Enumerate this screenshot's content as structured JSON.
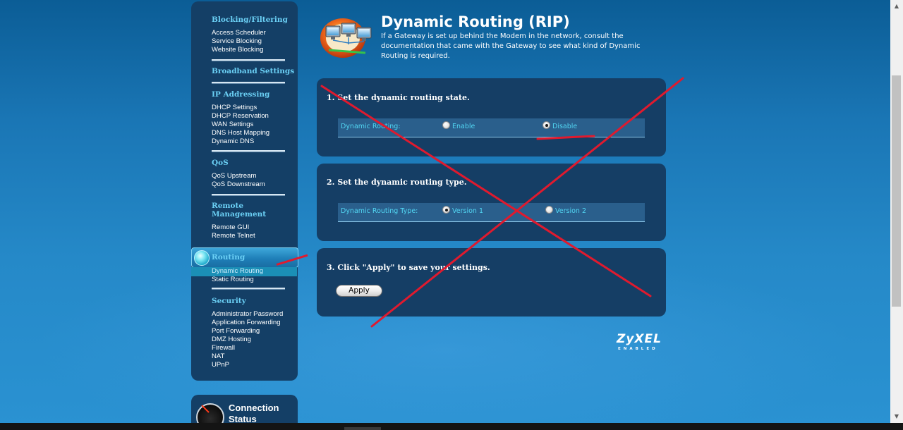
{
  "sidebar": {
    "sections": [
      {
        "heading": "Blocking/Filtering",
        "items": [
          "Access Scheduler",
          "Service Blocking",
          "Website Blocking"
        ]
      },
      {
        "heading": "Broadband Settings",
        "items": []
      },
      {
        "heading": "IP Addressing",
        "items": [
          "DHCP Settings",
          "DHCP Reservation",
          "WAN Settings",
          "DNS Host Mapping",
          "Dynamic DNS"
        ]
      },
      {
        "heading": "QoS",
        "items": [
          "QoS Upstream",
          "QoS Downstream"
        ]
      },
      {
        "heading": "Remote Management",
        "items": [
          "Remote GUI",
          "Remote Telnet"
        ]
      },
      {
        "heading": "Routing",
        "items": [
          "Dynamic Routing",
          "Static Routing"
        ],
        "active": true,
        "active_item": "Dynamic Routing"
      },
      {
        "heading": "Security",
        "items": [
          "Administrator Password",
          "Application Forwarding",
          "Port Forwarding",
          "DMZ Hosting",
          "Firewall",
          "NAT",
          "UPnP"
        ]
      }
    ],
    "remote_management_line1": "Remote",
    "remote_management_line2": "Management"
  },
  "connection_status": {
    "title": "Connection Status",
    "icon": "speedometer-icon"
  },
  "header": {
    "title": "Dynamic Routing (RIP)",
    "description": "If a Gateway is set up behind the Modem in the network, consult the documentation that came with the Gateway to see what kind of Dynamic Routing is required.",
    "icon": "network-computers-icon"
  },
  "step1": {
    "title": "1. Set the dynamic routing state.",
    "label": "Dynamic Routing:",
    "options": [
      "Enable",
      "Disable"
    ],
    "selected": "Disable"
  },
  "step2": {
    "title": "2. Set the dynamic routing type.",
    "label": "Dynamic Routing Type:",
    "options": [
      "Version 1",
      "Version 2"
    ],
    "selected": "Version 1"
  },
  "step3": {
    "title": "3. Click \"Apply\" to save your settings.",
    "apply_label": "Apply"
  },
  "logo": {
    "main": "ZyXEL",
    "sub": "ENABLED"
  },
  "colors": {
    "panel": "#153e65",
    "accent_cyan": "#52d6f3",
    "heading_cyan": "#6bd0f5",
    "annotation_red": "#e01a2e"
  }
}
